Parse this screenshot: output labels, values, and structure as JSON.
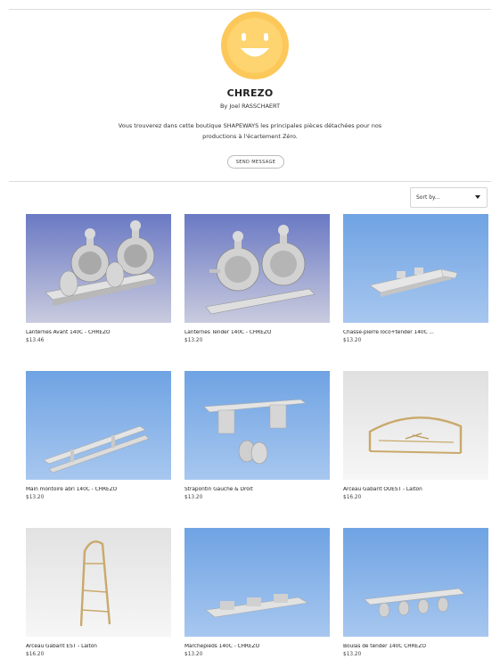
{
  "shop": {
    "name": "CHREZO",
    "byline": "By Joel RASSCHAERT",
    "description_line1": "Vous trouverez dans cette boutique SHAPEWAYS les principales pièces détachées pour nos",
    "description_line2": "productions à l'écartement Zéro.",
    "send_message_label": "SEND MESSAGE",
    "avatar_icon": "smiley-face-icon",
    "avatar_color": "#fcc85a"
  },
  "sort": {
    "label": "Sort by...",
    "icon": "caret-down-icon"
  },
  "products": [
    {
      "title": "Lanternes Avant 140C - CHREZO",
      "price": "$13.46"
    },
    {
      "title": "Lanternes Tender 140C - CHREZO",
      "price": "$13.20"
    },
    {
      "title": "Chasse-pierre loco+tender 140C ...",
      "price": "$13.20"
    },
    {
      "title": "Main montoire abri 140C - CHREZO",
      "price": "$13.20"
    },
    {
      "title": "Strapontin Gauche & Droit",
      "price": "$13.20"
    },
    {
      "title": "Arceau Gabarit OUEST - Laiton",
      "price": "$16.20"
    },
    {
      "title": "Arceau Gabarit EST - Laiton",
      "price": "$16.20"
    },
    {
      "title": "Marchepieds 140C - CHREZO",
      "price": "$13.20"
    },
    {
      "title": "Boulas de tender 140C CHREZO",
      "price": "$13.20"
    }
  ]
}
